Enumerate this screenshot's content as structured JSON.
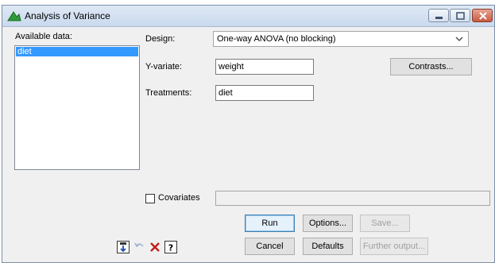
{
  "window": {
    "title": "Analysis of Variance"
  },
  "available_data": {
    "label": "Available data:",
    "items": [
      "diet"
    ]
  },
  "design": {
    "label": "Design:",
    "selected": "One-way ANOVA (no blocking)"
  },
  "y_variate": {
    "label": "Y-variate:",
    "value": "weight"
  },
  "treatments": {
    "label": "Treatments:",
    "value": "diet"
  },
  "contrasts_button": "Contrasts...",
  "covariates": {
    "label": "Covariates",
    "checked": false,
    "value": ""
  },
  "buttons": {
    "run": "Run",
    "options": "Options...",
    "save": "Save...",
    "cancel": "Cancel",
    "defaults": "Defaults",
    "further_output": "Further output..."
  },
  "icons": [
    "anova-icon",
    "minimize-icon",
    "maximize-icon",
    "close-icon",
    "paste-icon",
    "undo-icon",
    "clear-icon",
    "help-icon",
    "chevron-down-icon"
  ],
  "colors": {
    "selection": "#3399ff",
    "dialog_bg": "#f0f0f0",
    "close_button": "#c75b3f"
  }
}
